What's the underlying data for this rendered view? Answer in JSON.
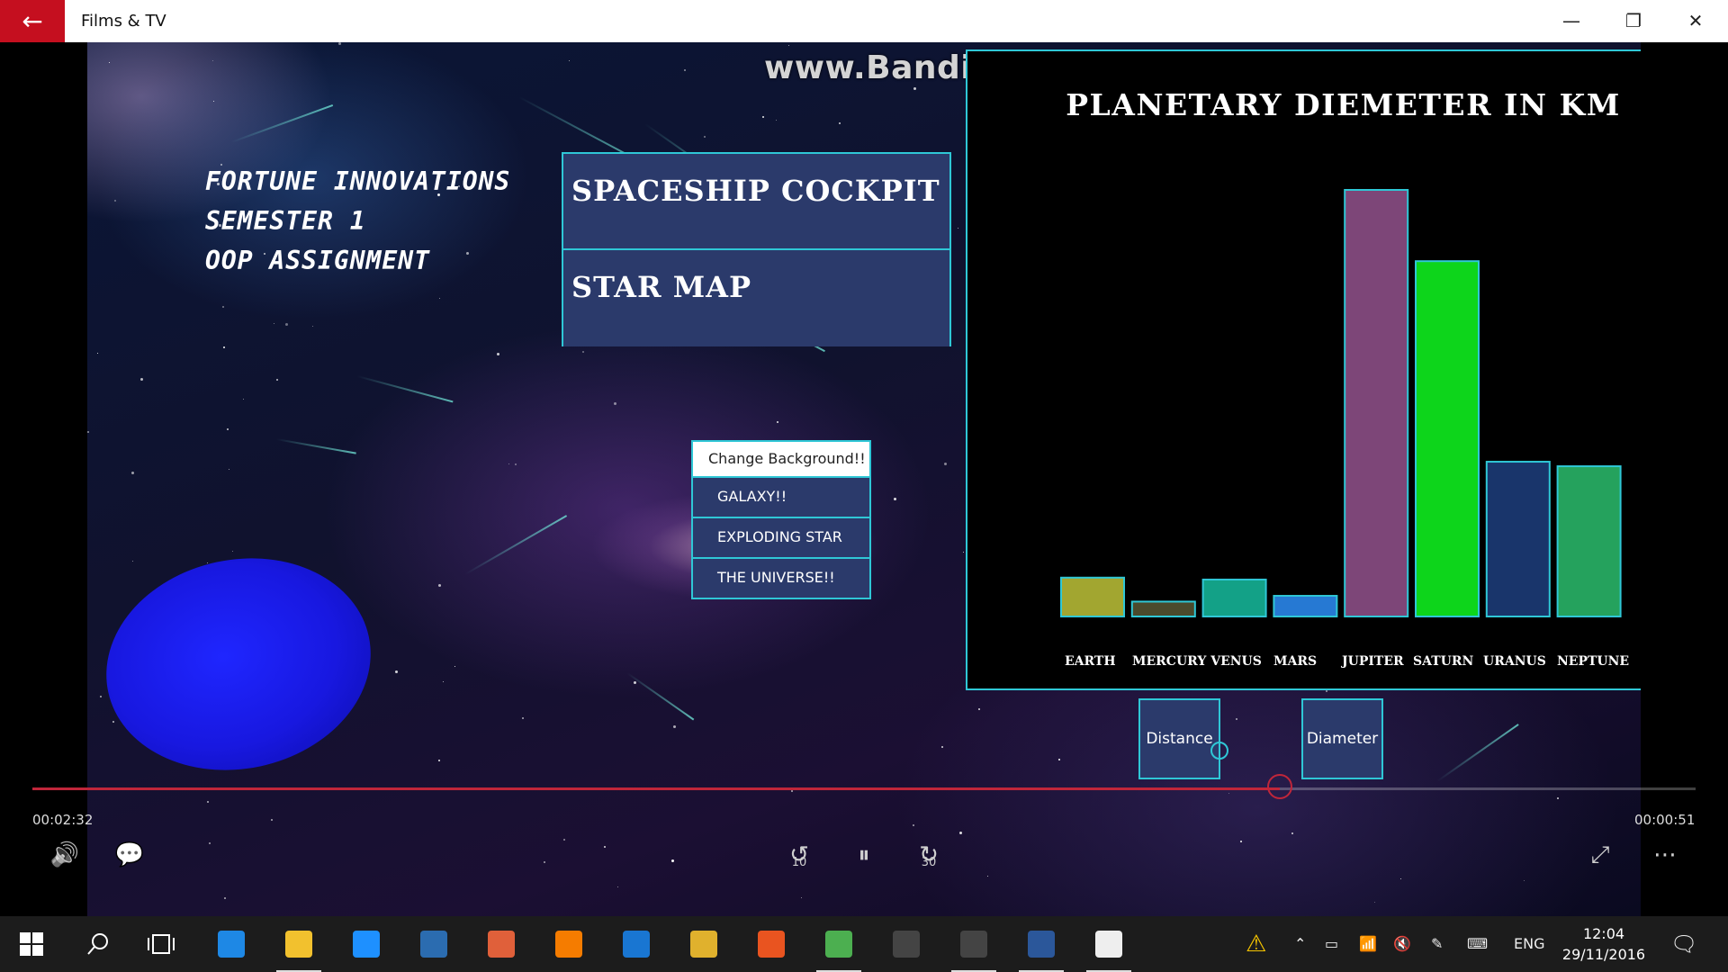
{
  "window": {
    "app_title": "Films & TV",
    "back_glyph": "←",
    "minimize_glyph": "—",
    "restore_glyph": "❐",
    "close_glyph": "✕"
  },
  "overlay": {
    "watermark": "www.Bandicam.com"
  },
  "app": {
    "org_lines": [
      "FORTUNE INNOVATIONS",
      "SEMESTER 1",
      "OOP ASSIGNMENT"
    ],
    "main_menu": [
      "SPACESHIP COCKPIT",
      "STAR MAP"
    ],
    "background_menu": {
      "header": "Change Background!!",
      "options": [
        "GALAXY!!",
        "EXPLODING STAR",
        "THE UNIVERSE!!"
      ]
    },
    "switch_buttons": {
      "distance": "Distance",
      "diameter": "Diameter"
    }
  },
  "chart_data": {
    "type": "bar",
    "title": "PLANETARY DIEMETER IN KM",
    "xlabel": "",
    "ylabel": "",
    "x_tick_labels": [
      "EARTH",
      "MERCURY VENUS",
      "MARS",
      "JUPITER",
      "SATURN",
      "URANUS",
      "NEPTUNE"
    ],
    "categories": [
      "EARTH",
      "MERCURY",
      "VENUS",
      "MARS",
      "JUPITER",
      "SATURN",
      "URANUS",
      "NEPTUNE"
    ],
    "values": [
      12742,
      4879,
      12104,
      6779,
      139820,
      116460,
      50724,
      49244
    ],
    "colors": [
      "#a2a630",
      "#4b4a2c",
      "#13a187",
      "#2679d3",
      "#7d4678",
      "#0dd51b",
      "#19356b",
      "#25a25d"
    ],
    "border_color": "#2fc7d6",
    "ylim": [
      0,
      139820
    ],
    "grid": false
  },
  "player": {
    "elapsed": "00:02:32",
    "remaining": "00:00:51",
    "progress": 0.75,
    "controls": {
      "volume_icon": "🔊",
      "subtitles_icon": "💬",
      "skip_back_icon": "↺",
      "skip_back_label": "10",
      "pause_icon": "⏸",
      "skip_forward_icon": "↻",
      "skip_forward_label": "30",
      "fullscreen_icon": "⤢",
      "more_icon": "⋯"
    }
  },
  "taskbar": {
    "apps": [
      {
        "name": "edge",
        "color": "#1e88e5",
        "active": false
      },
      {
        "name": "file-explorer",
        "color": "#f2c12e",
        "active": true
      },
      {
        "name": "dropbox",
        "color": "#1e90ff",
        "active": false
      },
      {
        "name": "touch",
        "color": "#2b6cb0",
        "active": false
      },
      {
        "name": "paint",
        "color": "#e0603a",
        "active": false
      },
      {
        "name": "firefox",
        "color": "#f57c00",
        "active": false
      },
      {
        "name": "cc3",
        "color": "#1976d2",
        "active": false
      },
      {
        "name": "chrome",
        "color": "#e0b12d",
        "active": false
      },
      {
        "name": "ubuntu",
        "color": "#e95420",
        "active": false
      },
      {
        "name": "gitkraken",
        "color": "#4caf50",
        "active": true
      },
      {
        "name": "app-p1",
        "color": "#444444",
        "active": false
      },
      {
        "name": "app-p2",
        "color": "#444444",
        "active": true
      },
      {
        "name": "word",
        "color": "#2b579a",
        "active": true
      },
      {
        "name": "films-tv",
        "color": "#eeeeee",
        "active": true
      }
    ],
    "language": "ENG",
    "time": "12:04",
    "date": "29/11/2016"
  }
}
